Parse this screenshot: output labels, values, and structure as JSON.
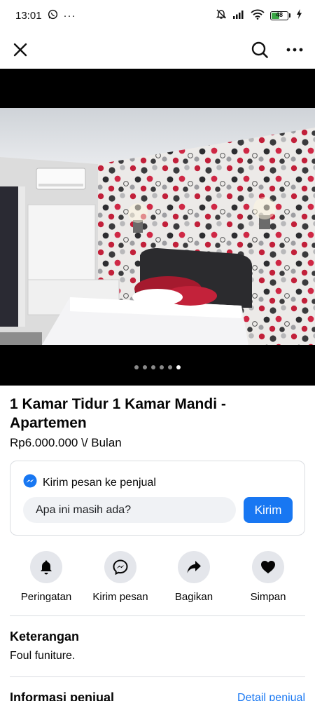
{
  "status_bar": {
    "time": "13:01",
    "battery": "48"
  },
  "listing": {
    "title": "1 Kamar Tidur 1 Kamar Mandi - Apartemen",
    "price": "Rp6.000.000 \\/ Bulan",
    "photo_count": 6,
    "active_photo_index": 5
  },
  "message": {
    "header": "Kirim pesan ke penjual",
    "input_value": "Apa ini masih ada?",
    "send_label": "Kirim"
  },
  "actions": [
    {
      "label": "Peringatan",
      "icon": "bell-icon"
    },
    {
      "label": "Kirim pesan",
      "icon": "messenger-icon"
    },
    {
      "label": "Bagikan",
      "icon": "share-icon"
    },
    {
      "label": "Simpan",
      "icon": "heart-icon"
    }
  ],
  "description": {
    "title": "Keterangan",
    "text": "Foul funiture."
  },
  "seller": {
    "title": "Informasi penjual",
    "detail_link": "Detail penjual"
  },
  "colors": {
    "accent": "#1877f2",
    "icon_bg": "#e4e6eb"
  }
}
